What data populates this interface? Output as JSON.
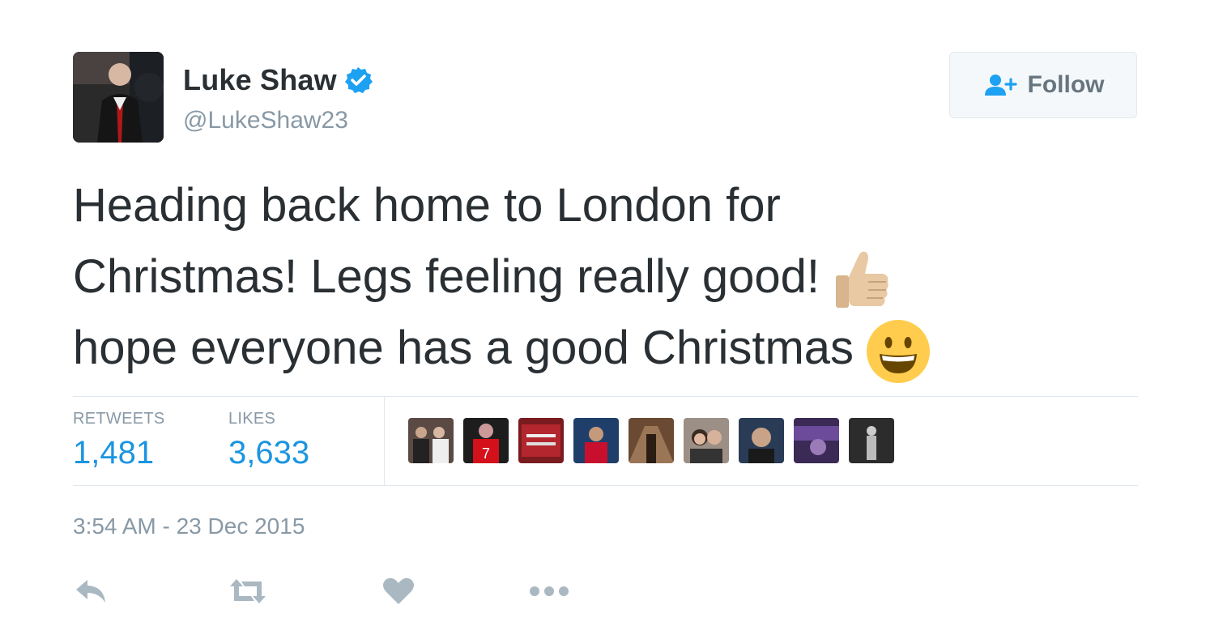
{
  "user": {
    "display_name": "Luke Shaw",
    "handle": "@LukeShaw23",
    "verified": true,
    "avatar_icon": "profile-photo"
  },
  "follow_button": {
    "label": "Follow",
    "icon": "follow-user-plus-icon"
  },
  "tweet": {
    "lines": [
      "Heading back home to London for",
      "Christmas! Legs feeling really good!",
      "hope everyone has a good Christmas"
    ],
    "emojis": [
      "thumbs-up-emoji",
      "grinning-face-emoji"
    ]
  },
  "stats": {
    "retweets_label": "RETWEETS",
    "retweets_value": "1,481",
    "likes_label": "LIKES",
    "likes_value": "3,633"
  },
  "likers_count_shown": 9,
  "timestamp": "3:54 AM - 23 Dec 2015",
  "actions": [
    "reply-icon",
    "retweet-icon",
    "like-heart-icon",
    "more-dots-icon"
  ],
  "colors": {
    "link_blue": "#1b95e0",
    "muted": "#8899a6",
    "action_gray": "#aab8c2",
    "verified_blue": "#1da1f2"
  }
}
